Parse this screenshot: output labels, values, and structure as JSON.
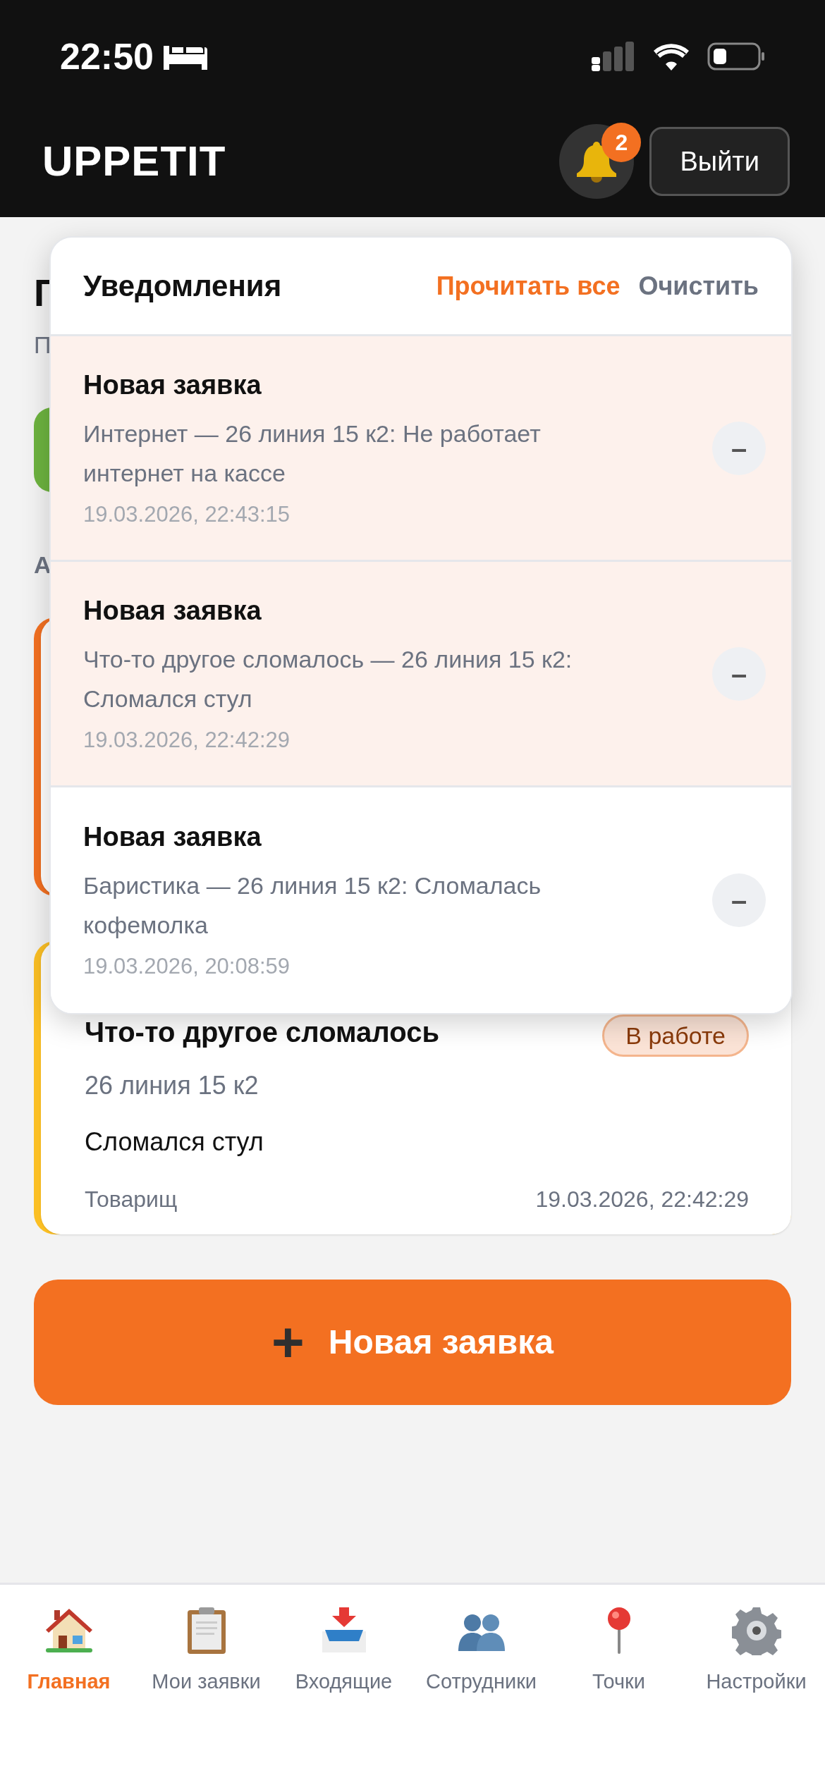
{
  "status_bar": {
    "time": "22:50"
  },
  "header": {
    "logo": "UPPETIT",
    "notification_count": "2",
    "logout": "Выйти"
  },
  "page": {
    "title": "Г",
    "subtitle": "П",
    "section_label": "А",
    "cards": [
      {
        "kind": "summary",
        "color": "#6db33f"
      },
      {
        "kind": "request",
        "color": "#f37021"
      },
      {
        "kind": "request",
        "color": "#fbbf24",
        "title": "Что-то другое сломалось",
        "status": "В работе",
        "address": "26 линия 15 к2",
        "description": "Сломался стул",
        "author": "Товарищ",
        "time": "19.03.2026, 22:42:29"
      }
    ]
  },
  "new_request_button": {
    "icon": "+",
    "label": "Новая заявка"
  },
  "notifications": {
    "title": "Уведомления",
    "read_all": "Прочитать все",
    "clear": "Очистить",
    "items": [
      {
        "title": "Новая заявка",
        "text": "Интернет — 26 линия 15 к2: Не работает интернет на кассе",
        "time": "19.03.2026, 22:43:15",
        "unread": true,
        "dismiss": "–"
      },
      {
        "title": "Новая заявка",
        "text": "Что-то другое сломалось — 26 линия 15 к2: Сломался стул",
        "time": "19.03.2026, 22:42:29",
        "unread": true,
        "dismiss": "–"
      },
      {
        "title": "Новая заявка",
        "text": "Баристика — 26 линия 15 к2: Сломалась кофемолка",
        "time": "19.03.2026, 20:08:59",
        "unread": false,
        "dismiss": "–"
      }
    ]
  },
  "nav": [
    {
      "kind": "home",
      "label": "Главная",
      "selected": true
    },
    {
      "kind": "clipboard",
      "label": "Мои заявки",
      "selected": false
    },
    {
      "kind": "inbox",
      "label": "Входящие",
      "selected": false
    },
    {
      "kind": "people",
      "label": "Сотрудники",
      "selected": false
    },
    {
      "kind": "pin",
      "label": "Точки",
      "selected": false
    },
    {
      "kind": "gear",
      "label": "Настройки",
      "selected": false
    }
  ]
}
